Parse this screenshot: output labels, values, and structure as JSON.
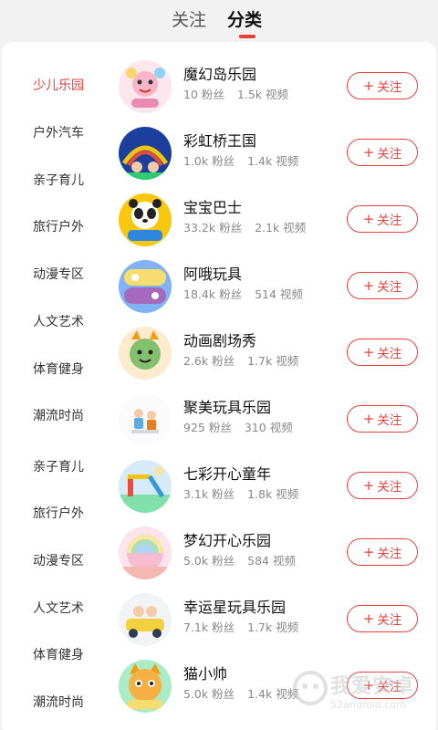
{
  "header": {
    "tabs": [
      {
        "label": "关注",
        "active": false
      },
      {
        "label": "分类",
        "active": true
      }
    ],
    "accent_color": "#e8413b"
  },
  "sidebar": {
    "items": [
      {
        "label": "少儿乐园",
        "active": true
      },
      {
        "label": "户外汽车",
        "active": false
      },
      {
        "label": "亲子育儿",
        "active": false
      },
      {
        "label": "旅行户外",
        "active": false
      },
      {
        "label": "动漫专区",
        "active": false
      },
      {
        "label": "人文艺术",
        "active": false
      },
      {
        "label": "体育健身",
        "active": false
      },
      {
        "label": "潮流时尚",
        "active": false
      },
      {
        "label": "亲子育儿",
        "active": false
      },
      {
        "label": "旅行户外",
        "active": false
      },
      {
        "label": "动漫专区",
        "active": false
      },
      {
        "label": "人文艺术",
        "active": false
      },
      {
        "label": "体育健身",
        "active": false
      },
      {
        "label": "潮流时尚",
        "active": false
      }
    ]
  },
  "channels": {
    "follow_label": "关注",
    "fans_suffix": "粉丝",
    "videos_suffix": "视频",
    "items": [
      {
        "name": "魔幻岛乐园",
        "fans": "10",
        "videos": "1.5k",
        "avatar": "pink-cartoon-avatar"
      },
      {
        "name": "彩虹桥王国",
        "fans": "1.0k",
        "videos": "1.4k",
        "avatar": "rainbow-kids-avatar"
      },
      {
        "name": "宝宝巴士",
        "fans": "33.2k",
        "videos": "2.1k",
        "avatar": "panda-bus-avatar"
      },
      {
        "name": "阿哦玩具",
        "fans": "18.4k",
        "videos": "514",
        "avatar": "toy-logo-avatar"
      },
      {
        "name": "动画剧场秀",
        "fans": "2.6k",
        "videos": "1.7k",
        "avatar": "green-creature-avatar"
      },
      {
        "name": "聚美玩具乐园",
        "fans": "925",
        "videos": "310",
        "avatar": "kids-playing-avatar"
      },
      {
        "name": "七彩开心童年",
        "fans": "3.1k",
        "videos": "1.8k",
        "avatar": "playground-avatar"
      },
      {
        "name": "梦幻开心乐园",
        "fans": "5.0k",
        "videos": "584",
        "avatar": "rainbow-ball-avatar"
      },
      {
        "name": "幸运星玩具乐园",
        "fans": "7.1k",
        "videos": "1.7k",
        "avatar": "kids-car-avatar"
      },
      {
        "name": "猫小帅",
        "fans": "5.0k",
        "videos": "1.4k",
        "avatar": "tiger-cat-avatar"
      }
    ]
  },
  "watermark": {
    "text": "我爱安卓",
    "url": "52android.com"
  }
}
